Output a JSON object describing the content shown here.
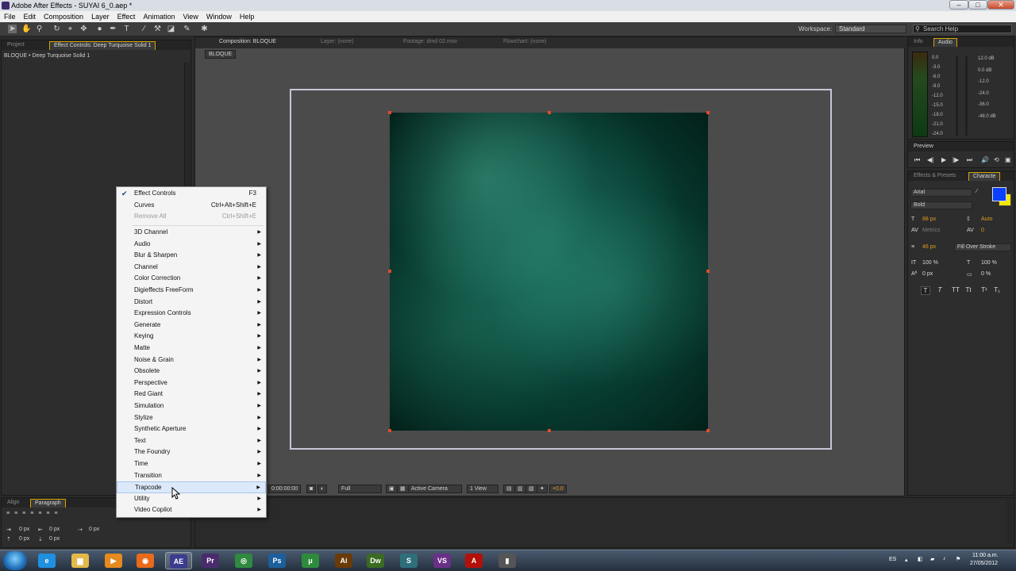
{
  "window": {
    "title": "Adobe After Effects - SUYAI 6_0.aep *",
    "minimize": "–",
    "maximize": "□",
    "close": "✕"
  },
  "menu": [
    "File",
    "Edit",
    "Composition",
    "Layer",
    "Effect",
    "Animation",
    "View",
    "Window",
    "Help"
  ],
  "toolbar": {
    "tools": [
      "selection-tool-icon",
      "hand-tool-icon",
      "zoom-tool-icon",
      "rotation-tool-icon",
      "camera-tool-icon",
      "pan-behind-icon",
      "mask-tool-icon",
      "pen-tool-icon",
      "type-tool-icon",
      "brush-tool-icon",
      "clone-stamp-icon",
      "eraser-icon",
      "roto-brush-icon",
      "puppet-pin-icon"
    ],
    "workspace_label": "Workspace:",
    "workspace_value": "Standard",
    "search_placeholder": "Search Help"
  },
  "left_panel": {
    "tabs": [
      "Project",
      "Effect Controls: Deep Turquoise Solid 1"
    ],
    "breadcrumb": "BLOQUE • Deep Turquoise Solid 1"
  },
  "composition_panel": {
    "tabs": [
      "Composition: BLOQUE",
      "Layer: (none)",
      "Footage: dmd 02.mov",
      "Flowchart: (none)"
    ],
    "sub_tab": "BLOQUE",
    "bottom_bar": {
      "timecode": "0:00:00:00",
      "resolution": "Full",
      "camera": "Active Camera",
      "views": "1 View",
      "exposure": "+0.0"
    }
  },
  "audio_panel": {
    "tabs": [
      "Info",
      "Audio"
    ],
    "db_left": [
      "0.0",
      "-3.0",
      "-6.0",
      "-9.0",
      "-12.0",
      "-15.0",
      "-18.0",
      "-21.0",
      "-24.0"
    ],
    "db_right": [
      "12.0 dB",
      "0.0 dB",
      "-12.0",
      "-24.0",
      "-36.0",
      "-48.0 dB"
    ]
  },
  "preview_panel": {
    "tab": "Preview",
    "controls": [
      "⏮",
      "◀|",
      "▶",
      "|▶",
      "⏭",
      "🔊",
      "⟲",
      "▣"
    ]
  },
  "character_panel": {
    "tabs": [
      "Effects & Presets",
      "Characte"
    ],
    "font": "Arial",
    "style": "Bold",
    "font_size": "88 px",
    "leading": "Auto",
    "kerning": "Metrics",
    "tracking": "0",
    "stroke_width": "46 px",
    "stroke_mode": "Fill Over Stroke",
    "vert_scale": "100 %",
    "horiz_scale": "100 %",
    "baseline_shift": "0 px",
    "tsume": "0 %",
    "text_styles": [
      "T",
      "T",
      "TT",
      "Tt",
      "T¹",
      "T₁"
    ],
    "fill_color": "#0a40ff",
    "stroke_color": "#f2e800"
  },
  "align_panel": {
    "tabs": [
      "Align",
      "Paragraph"
    ],
    "indent_values": [
      "0 px",
      "0 px",
      "0 px",
      "0 px",
      "0 px"
    ]
  },
  "context_menu": {
    "items": [
      {
        "label": "Effect Controls",
        "shortcut": "F3",
        "checked": true
      },
      {
        "label": "Curves",
        "shortcut": "Ctrl+Alt+Shift+E"
      },
      {
        "label": "Remove All",
        "shortcut": "Ctrl+Shift+E",
        "disabled": true
      },
      {
        "label": "3D Channel",
        "submenu": true
      },
      {
        "label": "Audio",
        "submenu": true
      },
      {
        "label": "Blur & Sharpen",
        "submenu": true
      },
      {
        "label": "Channel",
        "submenu": true
      },
      {
        "label": "Color Correction",
        "submenu": true
      },
      {
        "label": "Digieffects FreeForm",
        "submenu": true
      },
      {
        "label": "Distort",
        "submenu": true
      },
      {
        "label": "Expression Controls",
        "submenu": true
      },
      {
        "label": "Generate",
        "submenu": true
      },
      {
        "label": "Keying",
        "submenu": true
      },
      {
        "label": "Matte",
        "submenu": true
      },
      {
        "label": "Noise & Grain",
        "submenu": true
      },
      {
        "label": "Obsolete",
        "submenu": true
      },
      {
        "label": "Perspective",
        "submenu": true
      },
      {
        "label": "Red Giant",
        "submenu": true
      },
      {
        "label": "Simulation",
        "submenu": true
      },
      {
        "label": "Stylize",
        "submenu": true
      },
      {
        "label": "Synthetic Aperture",
        "submenu": true
      },
      {
        "label": "Text",
        "submenu": true
      },
      {
        "label": "The Foundry",
        "submenu": true
      },
      {
        "label": "Time",
        "submenu": true
      },
      {
        "label": "Transition",
        "submenu": true
      },
      {
        "label": "Trapcode",
        "submenu": true,
        "highlighted": true
      },
      {
        "label": "Utility",
        "submenu": true
      },
      {
        "label": "Video Copilot",
        "submenu": true
      }
    ]
  },
  "taskbar": {
    "apps": [
      {
        "name": "ie-icon",
        "label": "e",
        "color": "#1f8fe0"
      },
      {
        "name": "explorer-icon",
        "label": "▆",
        "color": "#e3b94a"
      },
      {
        "name": "media-player-icon",
        "label": "▶",
        "color": "#e68a1e"
      },
      {
        "name": "firefox-icon",
        "label": "◉",
        "color": "#e86a1a"
      },
      {
        "name": "after-effects-icon",
        "label": "AE",
        "color": "#3b3b8f",
        "active": true
      },
      {
        "name": "premiere-icon",
        "label": "Pr",
        "color": "#4a2c6e"
      },
      {
        "name": "chrome-icon",
        "label": "◎",
        "color": "#2f8a3f"
      },
      {
        "name": "photoshop-icon",
        "label": "Ps",
        "color": "#1c5f9c"
      },
      {
        "name": "utorrent-icon",
        "label": "μ",
        "color": "#2e8b3c"
      },
      {
        "name": "illustrator-icon",
        "label": "Ai",
        "color": "#6a3a08"
      },
      {
        "name": "dreamweaver-icon",
        "label": "Dw",
        "color": "#3b6b22"
      },
      {
        "name": "sync-icon",
        "label": "S",
        "color": "#2e6f7a"
      },
      {
        "name": "visual-studio-icon",
        "label": "VS",
        "color": "#6a2f88"
      },
      {
        "name": "acrobat-icon",
        "label": "A",
        "color": "#b3100a"
      },
      {
        "name": "misc-app-icon",
        "label": "▮",
        "color": "#555"
      }
    ],
    "language": "ES",
    "time": "11:00 a.m.",
    "date": "27/05/2012"
  }
}
